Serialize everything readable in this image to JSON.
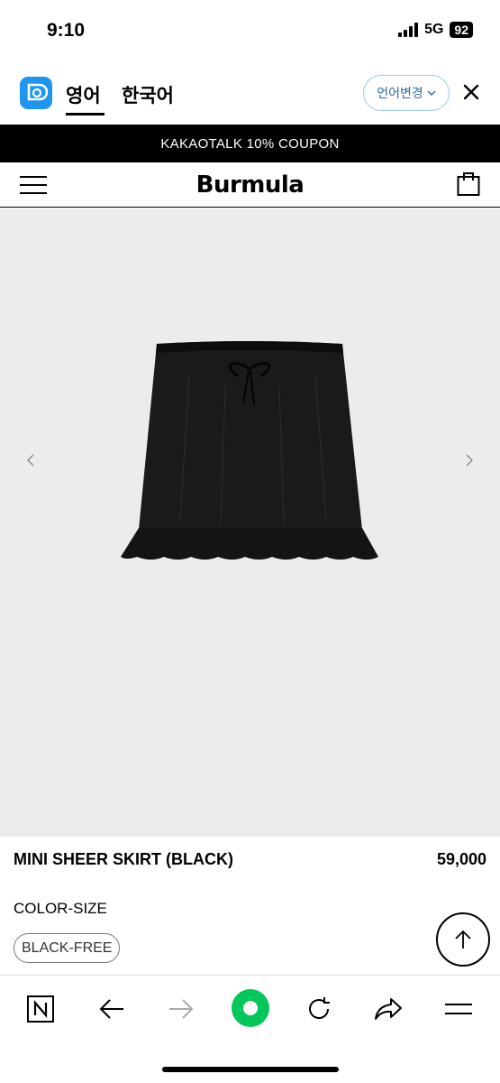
{
  "status_bar": {
    "time": "9:10",
    "network": "5G",
    "battery": "92"
  },
  "translate_bar": {
    "tab_active": "영어",
    "tab_inactive": "한국어",
    "language_button": "언어변경",
    "icons": {
      "logo": "papago-logo-icon",
      "dropdown": "chevron-down-icon",
      "close": "close-icon"
    }
  },
  "coupon_banner": {
    "text": "KAKAOTALK 10% COUPON"
  },
  "site_header": {
    "brand": "Burmula",
    "icons": [
      "menu-icon",
      "shopping-bag-icon"
    ]
  },
  "gallery": {
    "image_alt": "black sheer mini skirt",
    "icons": [
      "chevron-left-icon",
      "chevron-right-icon"
    ]
  },
  "product": {
    "name": "MINI SHEER SKIRT (BLACK)",
    "price": "59,000",
    "option_label": "COLOR-SIZE",
    "option_value": "BLACK-FREE"
  },
  "browser_toolbar": {
    "icons": [
      "naver-n-icon",
      "back-arrow-icon",
      "forward-arrow-icon",
      "green-home-icon",
      "refresh-icon",
      "share-icon",
      "menu-icon"
    ],
    "accent": "#03c75a"
  },
  "colors": {
    "banner_bg": "#000000",
    "image_bg": "#ececec",
    "lang_button_text": "#2a6db0",
    "logo_bg": "#1e96f0"
  }
}
